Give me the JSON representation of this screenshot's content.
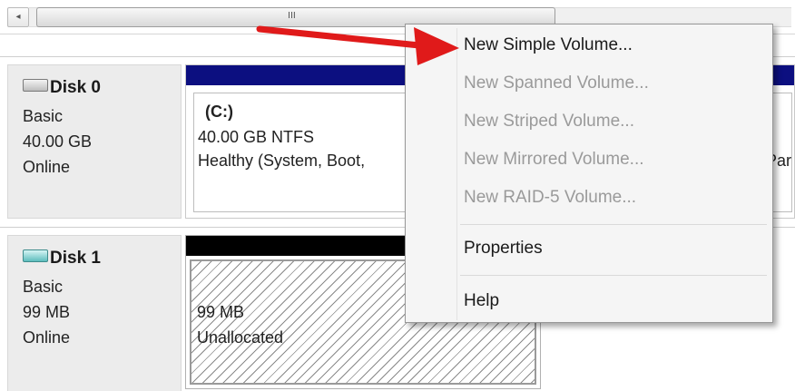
{
  "scrollbar": {
    "left_arrow": "◂",
    "thumb_grip": "III"
  },
  "disks": [
    {
      "name": "Disk 0",
      "type": "Basic",
      "size": "40.00 GB",
      "status": "Online"
    },
    {
      "name": "Disk 1",
      "type": "Basic",
      "size": "99 MB",
      "status": "Online"
    }
  ],
  "volumes": {
    "c": {
      "label": "(C:)",
      "size_fs": "40.00 GB NTFS",
      "status": "Healthy (System, Boot,",
      "cut_text": "Par"
    },
    "unallocated": {
      "size": "99 MB",
      "status": "Unallocated"
    }
  },
  "context_menu": {
    "items": [
      {
        "label": "New Simple Volume...",
        "enabled": true
      },
      {
        "label": "New Spanned Volume...",
        "enabled": false
      },
      {
        "label": "New Striped Volume...",
        "enabled": false
      },
      {
        "label": "New Mirrored Volume...",
        "enabled": false
      },
      {
        "label": "New RAID-5 Volume...",
        "enabled": false
      },
      {
        "label": "Properties",
        "enabled": true
      },
      {
        "label": "Help",
        "enabled": true
      }
    ]
  },
  "colors": {
    "primary_partition_bar": "#0c0f80",
    "unallocated_bar": "#000000",
    "annotation_arrow": "#e01a1a"
  },
  "icons": [
    "disk-drive-icon",
    "removable-disk-icon",
    "scroll-left-arrow-icon",
    "annotation-arrow"
  ]
}
